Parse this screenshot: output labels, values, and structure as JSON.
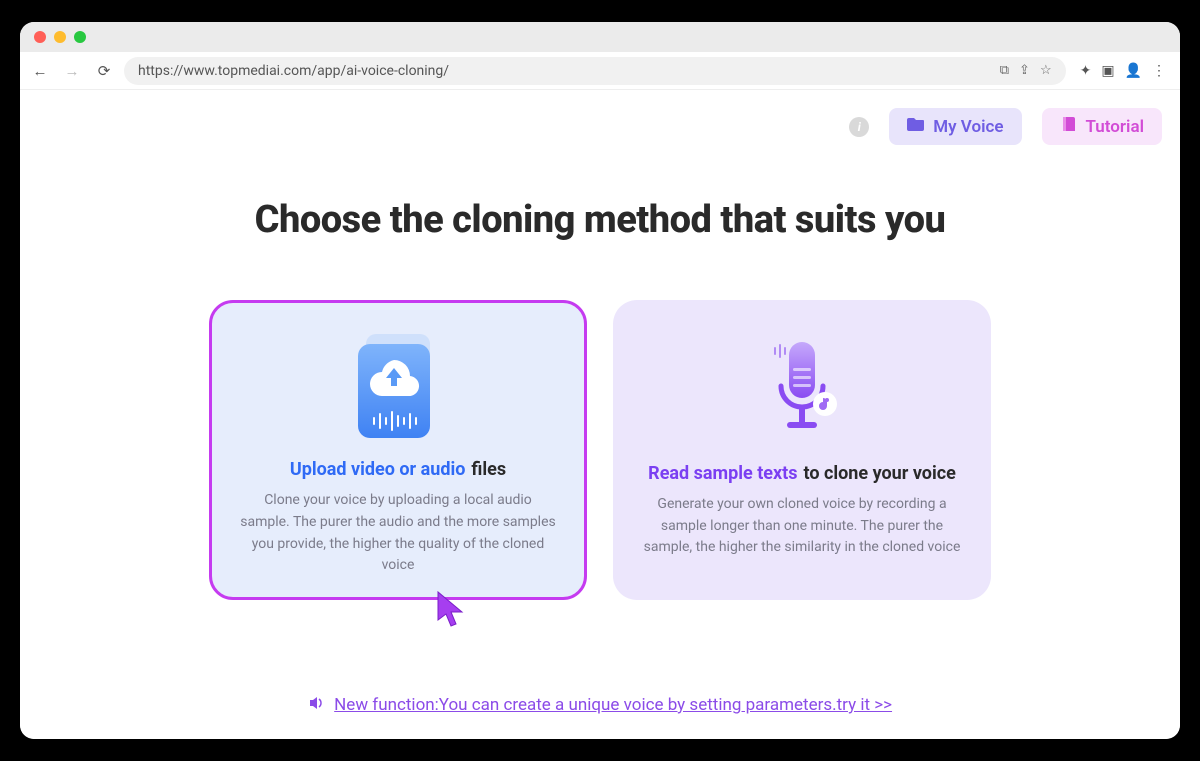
{
  "browser": {
    "url": "https://www.topmediai.com/app/ai-voice-cloning/"
  },
  "header": {
    "my_voice_label": "My Voice",
    "tutorial_label": "Tutorial"
  },
  "headline": "Choose the cloning method that suits you",
  "cards": {
    "upload": {
      "title_highlight": "Upload video or audio",
      "title_rest": "files",
      "description": "Clone your voice by uploading a local audio sample. The purer the audio and the more samples you provide, the higher the quality of the cloned voice"
    },
    "record": {
      "title_highlight": "Read sample texts",
      "title_rest": "to clone your voice",
      "description": "Generate your own cloned voice by recording a sample longer than one minute. The purer the sample, the higher the similarity in the cloned voice"
    }
  },
  "announcement": {
    "text": "New function:You can create a unique voice by setting parameters.try it >>"
  }
}
